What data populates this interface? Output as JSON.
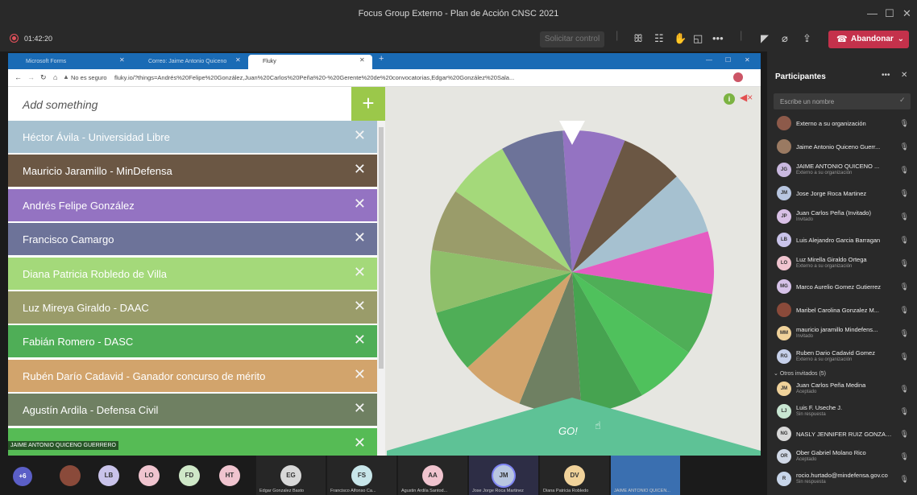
{
  "window": {
    "title": "Focus Group Externo - Plan de Acción CNSC 2021",
    "timer": "01:42:20",
    "request_control": "Solicitar control",
    "leave_label": "Abandonar"
  },
  "browser": {
    "tabs": [
      {
        "label": "Microsoft Forms"
      },
      {
        "label": "Correo: Jaime Antonio Quiceno"
      },
      {
        "label": "Fluky"
      }
    ],
    "security": "No es seguro",
    "url": "fluky.io/?things=Andrés%20Felipe%20González,Juan%20Carlos%20Peña%20-%20Gerente%20de%20convocatorias,Edgar%20González%20Sala..."
  },
  "fluky": {
    "add_placeholder": "Add something",
    "add_button": "+",
    "go_label": "GO!",
    "entries": [
      {
        "label": "Héctor Ávila - Universidad Libre",
        "color": "#a6c1d0"
      },
      {
        "label": "Mauricio Jaramillo - MinDefensa",
        "color": "#6b5744"
      },
      {
        "label": "Andrés Felipe González",
        "color": "#9473c2"
      },
      {
        "label": "Francisco Camargo",
        "color": "#6d7399"
      },
      {
        "label": "Diana Patricia Robledo de Villa",
        "color": "#a4d97a"
      },
      {
        "label": "Luz Mireya Giraldo - DAAC",
        "color": "#9a9c6a"
      },
      {
        "label": "Fabián Romero - DASC",
        "color": "#4fae57"
      },
      {
        "label": "Rubén Darío Cadavid - Ganador concurso de mérito",
        "color": "#d2a46c"
      },
      {
        "label": "Agustín Ardila - Defensa Civil",
        "color": "#6f8062"
      },
      {
        "label": "",
        "color": "#56bb55"
      }
    ],
    "wheel_colors": [
      "#9473c2",
      "#6b5744",
      "#a6c1d0",
      "#e55bc2",
      "#4fae57",
      "#4fc15c",
      "#46a350",
      "#6f8062",
      "#d2a46c",
      "#4fae57",
      "#8fbf6a",
      "#9a9c6a",
      "#a4d97a",
      "#6d7399"
    ]
  },
  "roster": {
    "title": "Participantes",
    "search_placeholder": "Escribe un nombre",
    "people": [
      {
        "name": "Externo a su organización",
        "sub": "",
        "initials": "",
        "color": "#8d5a4a"
      },
      {
        "name": "Jaime Antonio Quiceno Guerr...",
        "sub": "",
        "initials": "",
        "color": "#9a7a62"
      },
      {
        "name": "JAIME ANTONIO QUICENO ...",
        "sub": "Externo a su organización",
        "initials": "JG",
        "color": "#c9b8df"
      },
      {
        "name": "Jose Jorge Roca Martinez",
        "sub": "",
        "initials": "JM",
        "color": "#b8c6e0"
      },
      {
        "name": "Juan Carlos Peña (Invitado)",
        "sub": "Invitado",
        "initials": "JP",
        "color": "#d8c0e6"
      },
      {
        "name": "Luis Alejandro Garcia Barragan",
        "sub": "",
        "initials": "LB",
        "color": "#c9c3ea"
      },
      {
        "name": "Luz Mirella Giraldo Ortega",
        "sub": "Externo a su organización",
        "initials": "LO",
        "color": "#f0c4cf"
      },
      {
        "name": "Marco Aurelio Gomez Gutierrez",
        "sub": "",
        "initials": "MG",
        "color": "#d6c2e8"
      },
      {
        "name": "Maribel Carolina Gonzalez M...",
        "sub": "",
        "initials": "",
        "color": "#8a4a3a"
      },
      {
        "name": "mauricio jaramillo Mindefens...",
        "sub": "Invitado",
        "initials": "MM",
        "color": "#f0d29a"
      },
      {
        "name": "Ruben Dario Cadavid Gomez",
        "sub": "Externo a su organización",
        "initials": "RG",
        "color": "#c6d0ea"
      }
    ],
    "others_header": "Otros invitados (5)",
    "others": [
      {
        "name": "Juan Carlos Peña Medina",
        "sub": "Aceptado",
        "initials": "JM",
        "color": "#f0d29a"
      },
      {
        "name": "Luis F. Useche J.",
        "sub": "Sin respuesta",
        "initials": "LJ",
        "color": "#c8e6d2"
      },
      {
        "name": "NASLY JENNIFER RUIZ GONZALEZ",
        "sub": "",
        "initials": "NG",
        "color": "#d8d8d8"
      },
      {
        "name": "Ober Gabriel Molano Rico",
        "sub": "Aceptado",
        "initials": "OR",
        "color": "#d0d8e6"
      },
      {
        "name": "rocio.hurtado@mindefensa.gov.co",
        "sub": "Sin respuesta",
        "initials": "R",
        "color": "#c8d6ea"
      }
    ]
  },
  "gallery": {
    "extra_count": "+6",
    "presenter_label": "JAIME ANTONIO QUICENO GUERRERO",
    "avatars": [
      {
        "initials": "LB",
        "color": "#c9c3ea"
      },
      {
        "initials": "LO",
        "color": "#f0c4cf"
      },
      {
        "initials": "FD",
        "color": "#cfe8c8"
      },
      {
        "initials": "HT",
        "color": "#f0c4cf"
      }
    ],
    "tiles": [
      {
        "initials": "EG",
        "name": "Edgar Gonzalez Basto",
        "color": "#d8d8d8"
      },
      {
        "initials": "FS",
        "name": "Francisco Alfonso Ca...",
        "color": "#c8e6ea"
      },
      {
        "initials": "AA",
        "name": "Agustin Ardila Santod...",
        "color": "#f0c4cf"
      },
      {
        "initials": "JM",
        "name": "Jose Jorge Roca Martinez",
        "color": "#b8c6e0"
      },
      {
        "initials": "DV",
        "name": "Diana Patricia Robledo",
        "color": "#f0d29a"
      },
      {
        "initials": "",
        "name": "JAIME ANTONIO QUICEN...",
        "color": "#3a6fb0"
      }
    ]
  }
}
